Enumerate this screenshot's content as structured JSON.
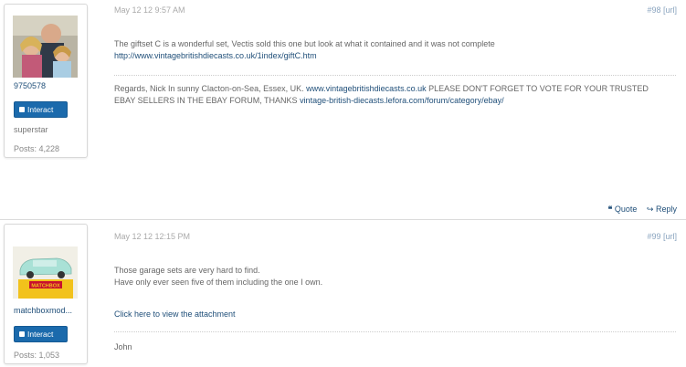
{
  "colors": {
    "link": "#21507a",
    "button": "#1b6aac",
    "muted": "#aaaaaa"
  },
  "posts": [
    {
      "date": "May 12 12 9:57 AM",
      "number": "#98",
      "url_label": "[url]",
      "username": "9750578",
      "interact_label": "Interact",
      "rank": "superstar",
      "post_count": "Posts: 4,228",
      "body_line1": "The giftset C is a wonderful set, Vectis sold this one but look at what it contained and it was not complete",
      "body_link": "http://www.vintagebritishdiecasts.co.uk/1index/giftC.htm",
      "sig_text1": "Regards, Nick In sunny Clacton-on-Sea, Essex, UK. ",
      "sig_link1": "www.vintagebritishdiecasts.co.uk",
      "sig_text2": " PLEASE DON'T FORGET TO VOTE FOR YOUR TRUSTED",
      "sig_text3": "EBAY SELLERS IN THE EBAY FORUM, THANKS ",
      "sig_link2": "vintage-british-diecasts.lefora.com/forum/category/ebay/",
      "quote_label": "Quote",
      "reply_label": "Reply"
    },
    {
      "date": "May 12 12 12:15 PM",
      "number": "#99",
      "url_label": "[url]",
      "username": "matchboxmod...",
      "interact_label": "Interact",
      "post_count": "Posts: 1,053",
      "avatar_text": "MATCHBOX",
      "body_line1": "Those garage sets are very hard to find.",
      "body_line2": "Have only ever seen five of them including the one I own.",
      "attachment_link": "Click here to view the attachment",
      "signature": "John"
    }
  ],
  "icons": {
    "quote": "quote-icon",
    "reply": "reply-arrow-icon"
  }
}
